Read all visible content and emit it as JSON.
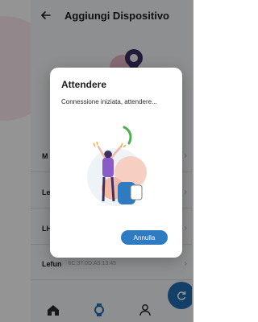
{
  "header": {
    "title": "Aggiungi Dispositivo"
  },
  "devices": [
    {
      "name": "M"
    },
    {
      "name": "Le"
    },
    {
      "name": "LH"
    },
    {
      "name": "Lefun",
      "mac": "6C:37:0D:A5:13:45"
    }
  ],
  "dialog": {
    "title": "Attendere",
    "message": "Connessione iniziata, attendere...",
    "cancel_label": "Annulla"
  },
  "icons": {
    "back": "arrow-left-icon",
    "home": "home-icon",
    "watch": "watch-icon",
    "profile": "person-icon",
    "refresh": "refresh-icon",
    "chevron": "chevron-right-icon"
  },
  "colors": {
    "accent": "#2f7bc1",
    "fab": "#1f6fb5"
  }
}
